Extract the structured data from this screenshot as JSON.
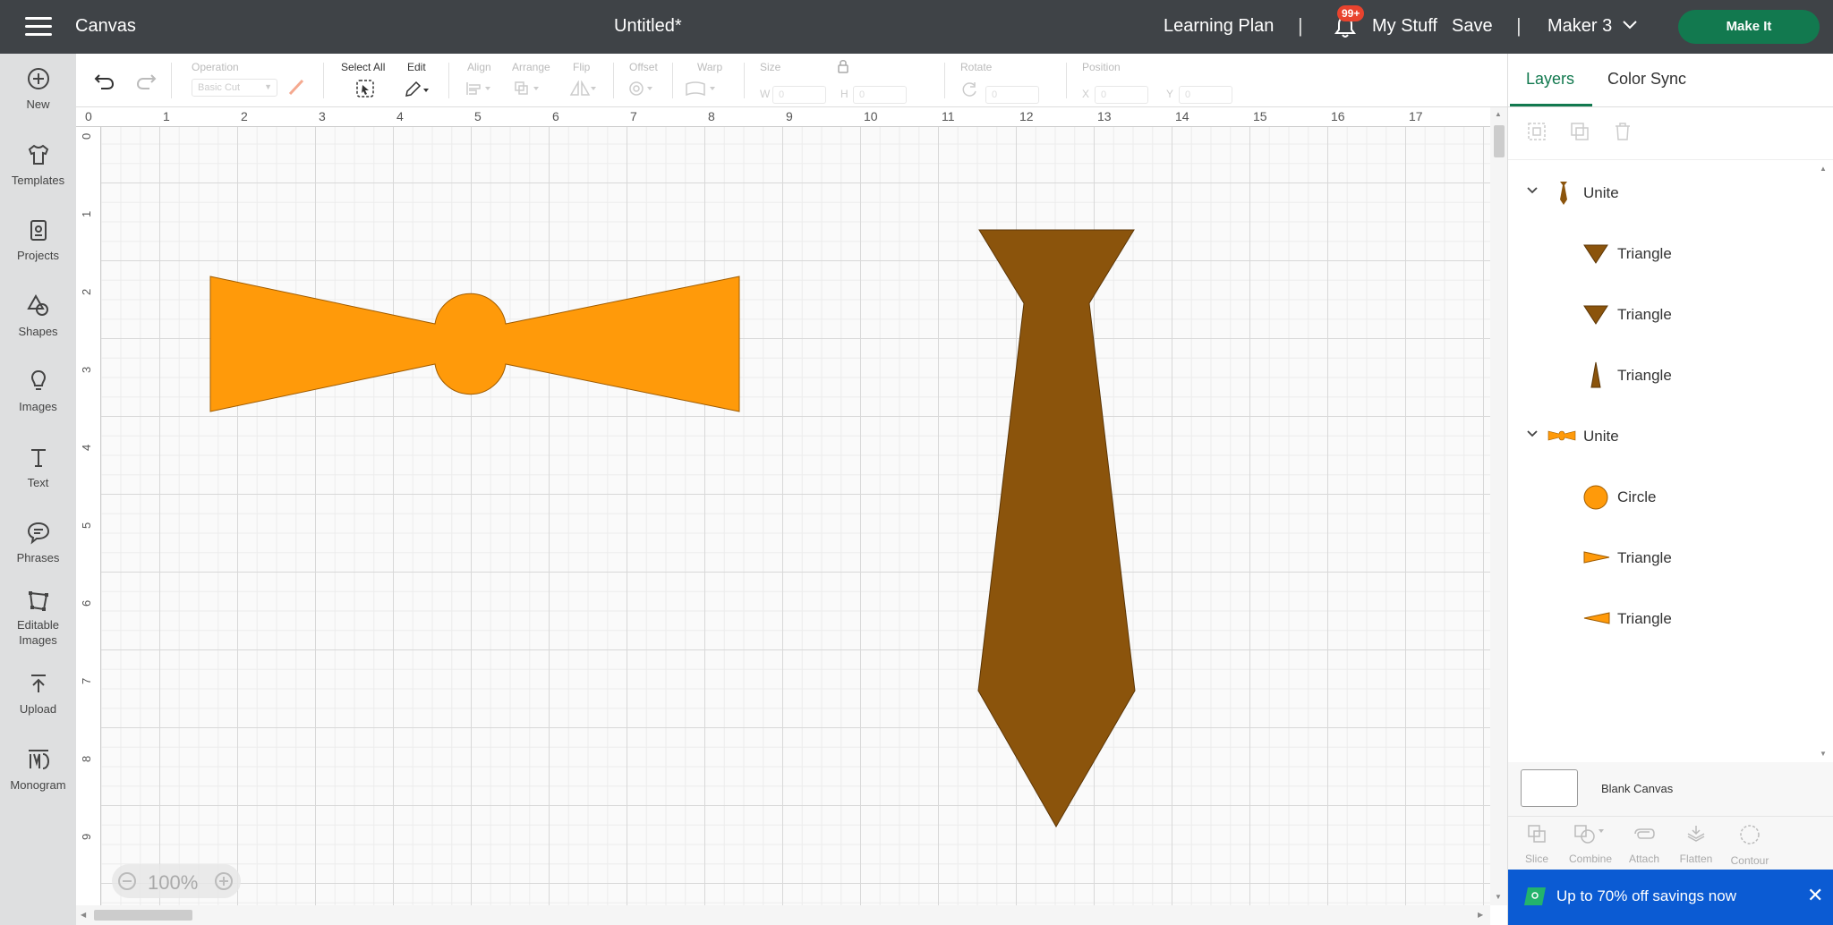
{
  "topbar": {
    "app_title": "Canvas",
    "doc_title": "Untitled*",
    "learning_plan": "Learning Plan",
    "notification_count": "99+",
    "my_stuff": "My Stuff",
    "save": "Save",
    "machine": "Maker 3",
    "make_it": "Make It",
    "sep": "|"
  },
  "sidebar": {
    "items": [
      {
        "label": "New",
        "icon": "plus-circle-icon"
      },
      {
        "label": "Templates",
        "icon": "shirt-icon"
      },
      {
        "label": "Projects",
        "icon": "projects-icon"
      },
      {
        "label": "Shapes",
        "icon": "shapes-icon"
      },
      {
        "label": "Images",
        "icon": "lightbulb-icon"
      },
      {
        "label": "Text",
        "icon": "text-icon"
      },
      {
        "label": "Phrases",
        "icon": "speech-bubble-icon"
      },
      {
        "label": "Editable Images",
        "icon": "editable-images-icon"
      },
      {
        "label": "Upload",
        "icon": "upload-icon"
      },
      {
        "label": "Monogram",
        "icon": "monogram-icon"
      }
    ]
  },
  "toolbar": {
    "operation_label": "Operation",
    "operation_value": "Basic Cut",
    "select_all": "Select All",
    "edit": "Edit",
    "align": "Align",
    "arrange": "Arrange",
    "flip": "Flip",
    "offset": "Offset",
    "warp": "Warp",
    "size": "Size",
    "w_label": "W",
    "h_label": "H",
    "w_value": "0",
    "h_value": "0",
    "rotate": "Rotate",
    "rotate_value": "0",
    "position": "Position",
    "x_label": "X",
    "y_label": "Y",
    "x_value": "0",
    "y_value": "0"
  },
  "canvas": {
    "ruler_x": [
      "0",
      "1",
      "2",
      "3",
      "4",
      "5",
      "6",
      "7",
      "8",
      "9",
      "10",
      "11",
      "12",
      "13",
      "14",
      "15",
      "16",
      "17"
    ],
    "ruler_y": [
      "0",
      "1",
      "2",
      "3",
      "4",
      "5",
      "6",
      "7",
      "8",
      "9"
    ],
    "zoom": "100%",
    "bowtie_color": "#ff9a0a",
    "tie_color": "#8b540c"
  },
  "panel": {
    "tabs": [
      "Layers",
      "Color Sync"
    ],
    "groups": [
      {
        "name": "Unite",
        "children": [
          "Triangle",
          "Triangle",
          "Triangle"
        ]
      },
      {
        "name": "Unite",
        "children": [
          "Circle",
          "Triangle",
          "Triangle"
        ]
      }
    ],
    "blank_canvas": "Blank Canvas",
    "actions": [
      "Slice",
      "Combine",
      "Attach",
      "Flatten",
      "Contour"
    ],
    "promo": "Up to 70% off savings now",
    "accent": "#12794f"
  }
}
